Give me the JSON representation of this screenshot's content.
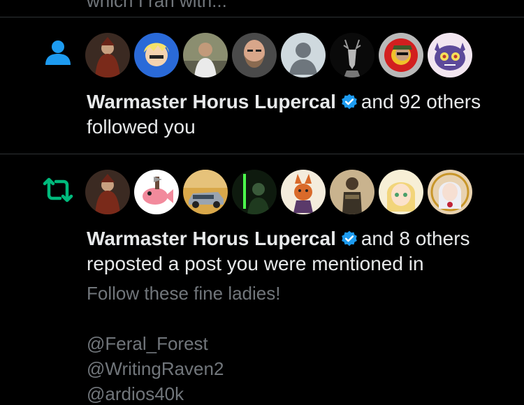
{
  "partial_top_text": "which I ran with...",
  "notifications": [
    {
      "type_icon": "person-icon",
      "avatars": [
        "avatar-horus",
        "avatar-anime-blonde",
        "avatar-man-office",
        "avatar-bearded-man",
        "avatar-default",
        "avatar-stag",
        "avatar-soldier-cartoon",
        "avatar-purple-pokemon"
      ],
      "name": "Warmaster Horus Lupercal",
      "others": "and 92 others",
      "action": "followed you"
    },
    {
      "type_icon": "repost-icon",
      "avatars": [
        "avatar-horus",
        "avatar-pink-fish",
        "avatar-car",
        "avatar-green-lightsaber",
        "avatar-fox-art",
        "avatar-armored-soldier",
        "avatar-anime-girl",
        "avatar-white-hair-anime"
      ],
      "name": "Warmaster Horus Lupercal",
      "others": "and 8 others",
      "action": "reposted a post you were mentioned in",
      "post_text": "Follow these fine ladies!",
      "mentions": [
        "@Feral_Forest",
        "@WritingRaven2",
        "@ardios40k"
      ]
    }
  ],
  "colors": {
    "accent": "#1d9bf0",
    "repost": "#00ba7c",
    "muted": "#71767b"
  }
}
